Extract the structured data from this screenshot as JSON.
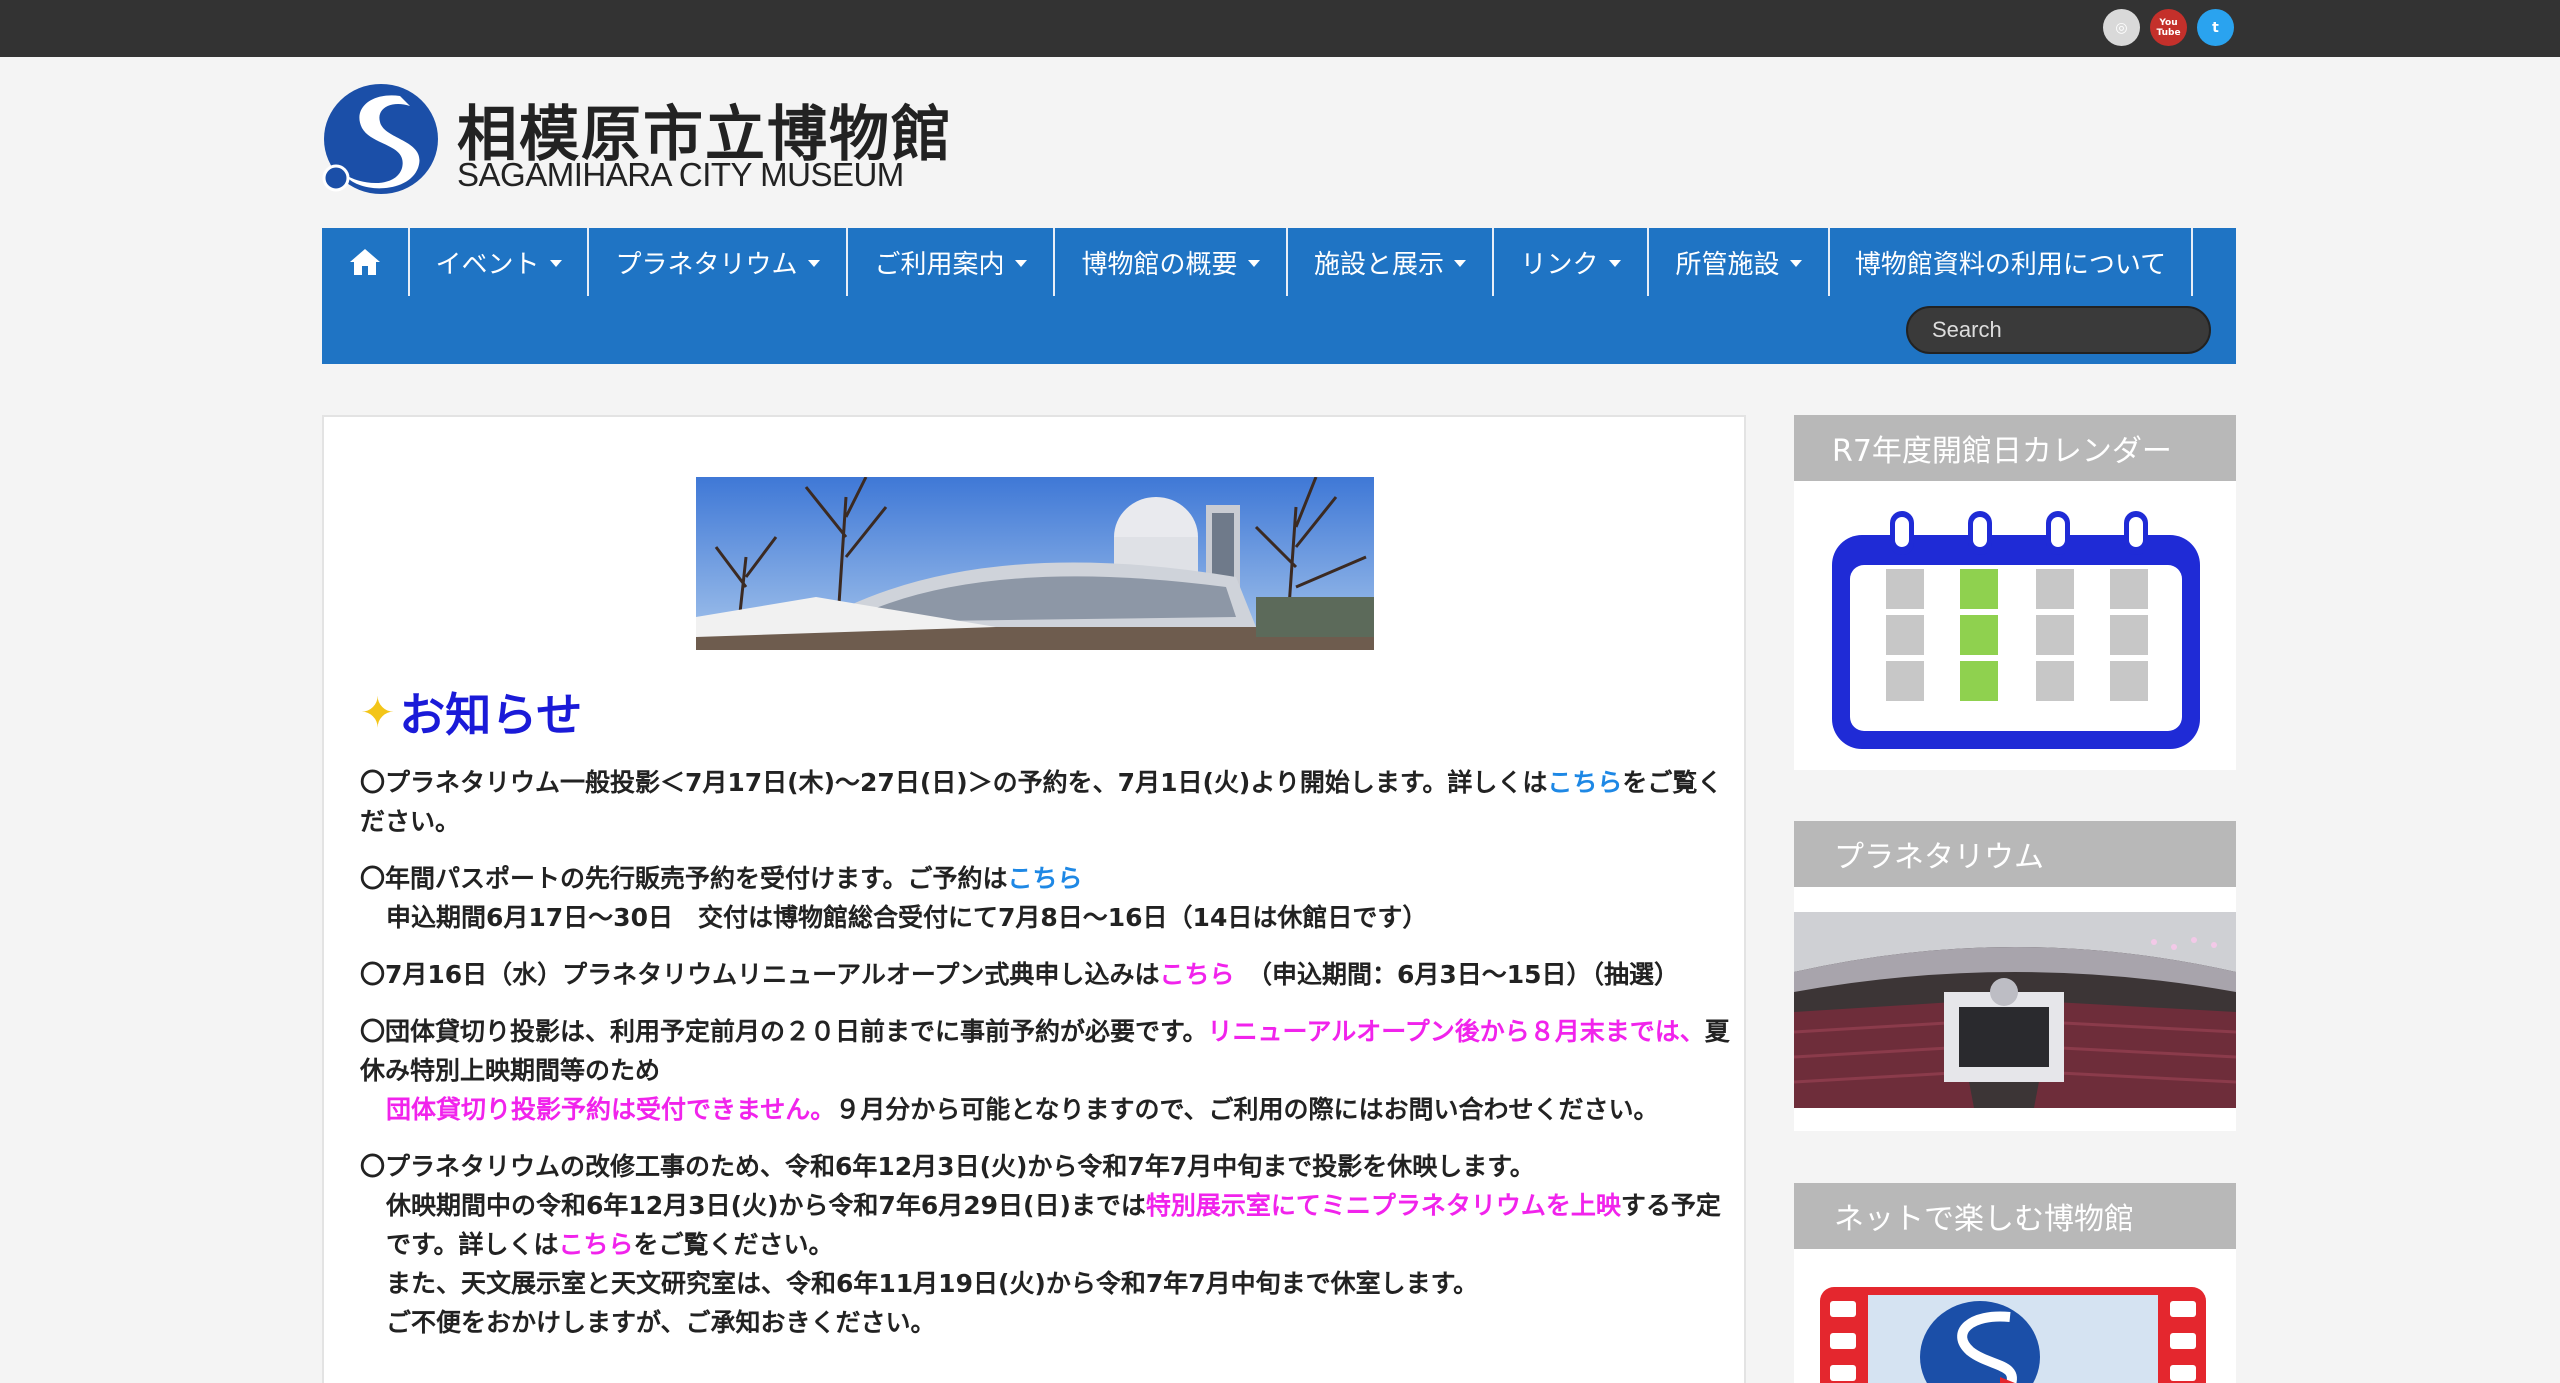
{
  "social": {
    "instagram_label": "◎",
    "youtube_label": "You Tube",
    "twitter_label": "t"
  },
  "logo": {
    "jp": "相模原市立博物館",
    "en": "SAGAMIHARA CITY MUSEUM"
  },
  "nav": {
    "home_icon": "home-icon",
    "items": [
      {
        "label": "イベント",
        "dropdown": true
      },
      {
        "label": "プラネタリウム",
        "dropdown": true
      },
      {
        "label": "ご利用案内",
        "dropdown": true
      },
      {
        "label": "博物館の概要",
        "dropdown": true
      },
      {
        "label": "施設と展示",
        "dropdown": true
      },
      {
        "label": "リンク",
        "dropdown": true
      },
      {
        "label": "所管施設",
        "dropdown": true
      },
      {
        "label": "博物館資料の利用について",
        "dropdown": false
      }
    ],
    "search_placeholder": "Search"
  },
  "main": {
    "heading": "お知らせ",
    "notices": [
      {
        "a": "〇プラネタリウム一般投影＜7月17日(木)〜27日(日)＞の予約を、7月1日(火)より開始します。詳しくは",
        "link": "こちら",
        "b": "をご覧ください。"
      },
      {
        "a": "〇年間パスポートの先行販売予約を受付けます。ご予約は",
        "link": "こちら",
        "line2": "申込期間6月17日〜30日　交付は博物館総合受付にて7月8日〜16日（14日は休館日です）"
      },
      {
        "a": "〇7月16日（水）プラネタリウムリニューアルオープン式典申し込みは",
        "link": "こちら",
        "b": "　（申込期間：6月3日〜15日）（抽選）"
      },
      {
        "a": "〇団体貸切り投影は、利用予定前月の２０日前までに事前予約が必要です。",
        "pink1": "リニューアルオープン後から８月末までは、",
        "b": "夏休み特別上映期間等のため",
        "pink2": "団体貸切り投影予約は受付できません。",
        "c": "９月分から可能となりますので、ご利用の際にはお問い合わせください。"
      },
      {
        "a": "〇プラネタリウムの改修工事のため、令和6年12月3日(火)から令和7年7月中旬まで投影を休映します。",
        "b": "休映期間中の令和6年12月3日(火)から令和7年6月29日(日)までは",
        "pink": "特別展示室にてミニプラネタリウムを上映",
        "c": "する予定です。詳しくは",
        "link": "こちら",
        "d": "をご覧ください。",
        "e": "また、天文展示室と天文研究室は、令和6年11月19日(火)から令和7年7月中旬まで休室します。",
        "f": "ご不便をおかけしますが、ご承知おきください。"
      }
    ]
  },
  "sidebar": {
    "calendar_title": "R7年度開館日カレンダー",
    "planetarium_title": "プラネタリウム",
    "online_title": "ネットで楽しむ博物館"
  },
  "colors": {
    "nav_blue": "#1f74c4",
    "heading_blue": "#1a1ad8",
    "link_blue": "#1e88e5",
    "pink": "#f123ec",
    "widget_title_gray": "#b8b8b8"
  }
}
